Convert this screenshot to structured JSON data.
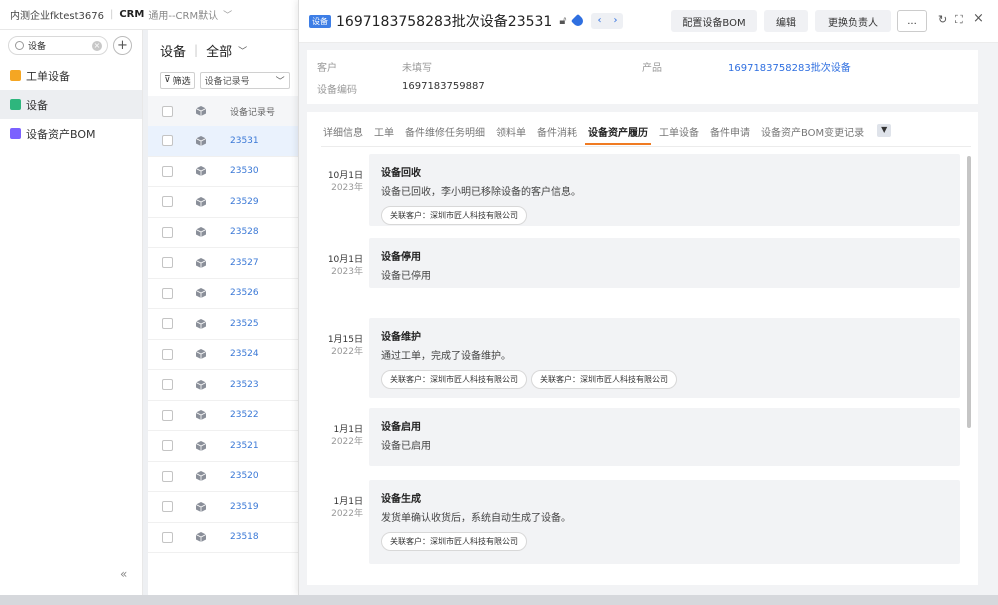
{
  "topbar": {
    "company": "内测企业fktest3676",
    "app": "CRM",
    "view": "通用--CRM默认"
  },
  "sidebar": {
    "search_value": "设备",
    "items": [
      {
        "label": "工单设备",
        "icon": "ticket-icon",
        "color": "#f5a623"
      },
      {
        "label": "设备",
        "icon": "device-icon",
        "color": "#2eb67d"
      },
      {
        "label": "设备资产BOM",
        "icon": "bom-icon",
        "color": "#7b61ff"
      }
    ],
    "collapse": "«"
  },
  "list": {
    "title": "设备",
    "scope": "全部",
    "filter_label": "筛选",
    "filter_field": "设备记录号",
    "column_header": "设备记录号",
    "rows": [
      "23531",
      "23530",
      "23529",
      "23528",
      "23527",
      "23526",
      "23525",
      "23524",
      "23523",
      "23522",
      "23521",
      "23520",
      "23519",
      "23518"
    ]
  },
  "detail": {
    "object_tag": "设备",
    "title": "1697183758283批次设备23531",
    "buttons": {
      "config_bom": "配置设备BOM",
      "edit": "编辑",
      "change_owner": "更换负责人",
      "more": "..."
    },
    "info": {
      "customer_label": "客户",
      "customer_value": "未填写",
      "product_label": "产品",
      "product_value": "1697183758283批次设备",
      "code_label": "设备编码",
      "code_value": "1697183759887"
    },
    "tabs": [
      "详细信息",
      "工单",
      "备件维修任务明细",
      "领料单",
      "备件消耗",
      "设备资产履历",
      "工单设备",
      "备件申请",
      "设备资产BOM变更记录"
    ],
    "active_tab": "设备资产履历",
    "timeline": [
      {
        "date": "10月1日",
        "year": "2023年",
        "title": "设备回收",
        "desc": "设备已回收，李小明已移除设备的客户信息。",
        "pills": [
          "关联客户：深圳市匠人科技有限公司"
        ]
      },
      {
        "date": "10月1日",
        "year": "2023年",
        "title": "设备停用",
        "desc": "设备已停用",
        "pills": []
      },
      {
        "date": "1月15日",
        "year": "2022年",
        "title": "设备维护",
        "desc": "通过工单，完成了设备维护。",
        "pills": [
          "关联客户：深圳市匠人科技有限公司",
          "关联客户：深圳市匠人科技有限公司"
        ]
      },
      {
        "date": "1月1日",
        "year": "2022年",
        "title": "设备启用",
        "desc": "设备已启用",
        "pills": []
      },
      {
        "date": "1月1日",
        "year": "2022年",
        "title": "设备生成",
        "desc": "发货单确认收货后，系统自动生成了设备。",
        "pills": [
          "关联客户：深圳市匠人科技有限公司"
        ]
      }
    ]
  }
}
